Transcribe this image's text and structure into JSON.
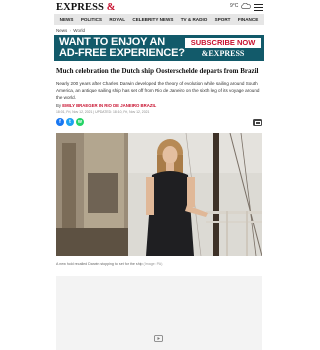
{
  "masthead": {
    "logo_text": "EXPRESS",
    "logo_mark": "&",
    "weather_temp": "9°C",
    "weather_icon": "cloud-icon",
    "menu_icon": "hamburger-icon"
  },
  "nav": {
    "items": [
      "NEWS",
      "POLITICS",
      "ROYAL",
      "CELEBRITY NEWS",
      "TV & RADIO",
      "SPORT",
      "FINANCE"
    ]
  },
  "breadcrumb": {
    "items": [
      "News",
      "World"
    ],
    "separator": "›"
  },
  "promo": {
    "line1": "WANT TO ENJOY AN",
    "line2": "AD-FREE EXPERIENCE?",
    "button": "SUBSCRIBE NOW",
    "brand": "EXPRESS",
    "brand_mark": "&",
    "bg_color": "#125a6a",
    "accent_color": "#c8102e"
  },
  "article": {
    "headline": "Much celebration the Dutch ship Oosterschelde departs from Brazil",
    "standfirst": "Nearly 200 years after Charles Darwin developed the theory of evolution while sailing around South America, an antique sailing ship has set off from Rio de Janeiro on the sixth leg of its voyage around the world.",
    "byline_prefix": "By",
    "author": "EMILY BRAEGER IN RIO DE JANEIRO BRAZIL",
    "dates": "18:01, Fri, Nov 12, 2021 | UPDATED: 18:10, Fri, Nov 12, 2021"
  },
  "share": {
    "facebook_icon": "f",
    "twitter_icon": "t",
    "whatsapp_icon": "w"
  },
  "caption": {
    "text": "A new hold recalled Darwin stopping to set for the ship",
    "credit": "(Image: PA)"
  }
}
